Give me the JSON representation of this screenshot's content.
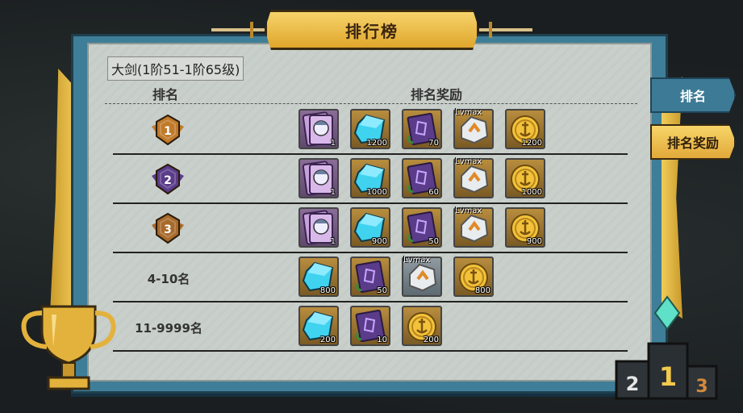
{
  "title": "排行榜",
  "subtitle": "大剑(1阶51-1阶65级)",
  "headers": {
    "rank": "排名",
    "rewards": "排名奖励"
  },
  "tabs": {
    "rank": "排名",
    "reward": "排名奖励"
  },
  "rows": [
    {
      "rank_label": "",
      "badge": "1",
      "badge_color": "#c07a2a",
      "items": [
        {
          "kind": "card",
          "qty": "1",
          "quality": "purple"
        },
        {
          "kind": "crystal",
          "qty": "1200",
          "quality": "orange"
        },
        {
          "kind": "book",
          "qty": "70",
          "quality": "orange"
        },
        {
          "kind": "stone",
          "qty": "",
          "lv": "Lvmax",
          "quality": "orange"
        },
        {
          "kind": "coin",
          "qty": "1200",
          "quality": "orange"
        }
      ]
    },
    {
      "rank_label": "",
      "badge": "2",
      "badge_color": "#5a3c8a",
      "items": [
        {
          "kind": "card",
          "qty": "1",
          "quality": "purple"
        },
        {
          "kind": "crystal",
          "qty": "1000",
          "quality": "orange"
        },
        {
          "kind": "book",
          "qty": "60",
          "quality": "orange"
        },
        {
          "kind": "stone",
          "qty": "",
          "lv": "Lvmax",
          "quality": "orange"
        },
        {
          "kind": "coin",
          "qty": "1000",
          "quality": "orange"
        }
      ]
    },
    {
      "rank_label": "",
      "badge": "3",
      "badge_color": "#a86a2a",
      "items": [
        {
          "kind": "card",
          "qty": "1",
          "quality": "purple"
        },
        {
          "kind": "crystal",
          "qty": "900",
          "quality": "orange"
        },
        {
          "kind": "book",
          "qty": "50",
          "quality": "orange"
        },
        {
          "kind": "stone",
          "qty": "",
          "lv": "Lvmax",
          "quality": "orange"
        },
        {
          "kind": "coin",
          "qty": "900",
          "quality": "orange"
        }
      ]
    },
    {
      "rank_label": "4-10名",
      "badge": "",
      "items": [
        {
          "kind": "crystal",
          "qty": "800",
          "quality": "orange"
        },
        {
          "kind": "book",
          "qty": "50",
          "quality": "orange"
        },
        {
          "kind": "stone",
          "qty": "",
          "lv": "Lvmax",
          "quality": "gray"
        },
        {
          "kind": "coin",
          "qty": "800",
          "quality": "orange"
        }
      ]
    },
    {
      "rank_label": "11-9999名",
      "badge": "",
      "items": [
        {
          "kind": "crystal",
          "qty": "200",
          "quality": "orange"
        },
        {
          "kind": "book",
          "qty": "10",
          "quality": "orange"
        },
        {
          "kind": "coin",
          "qty": "200",
          "quality": "orange"
        }
      ]
    }
  ],
  "podium": {
    "left": "2",
    "center": "1",
    "right": "3"
  },
  "colors": {
    "accent": "#e6b13e",
    "frame": "#3f7e98",
    "panel": "#c9cfcb"
  }
}
